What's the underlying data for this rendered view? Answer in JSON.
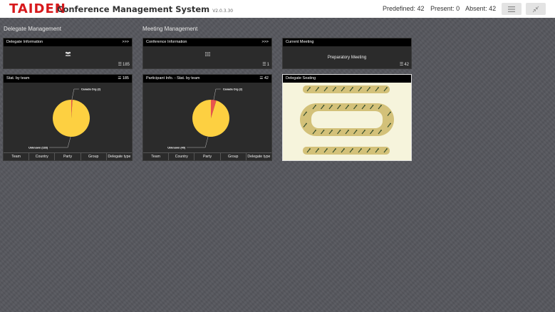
{
  "header": {
    "brand": "TAIDEN",
    "title": "Conference Management System",
    "version": "V2.0.3.30",
    "predefined": "Predefined: 42",
    "present": "Present: 0",
    "absent": "Absent: 42",
    "menu_icon": "menu-icon",
    "collapse_icon": "collapse-icon"
  },
  "sections": {
    "delegate": "Delegate Management",
    "meeting": "Meeting Management"
  },
  "panels": {
    "delegate_info": {
      "title": "Delegate Information",
      "more": ">>>",
      "count": "185",
      "icon": "users-icon"
    },
    "conference_info": {
      "title": "Conference Information",
      "more": ">>>",
      "count": "1",
      "icon": "list-icon"
    },
    "current_meeting": {
      "title": "Current Meeting",
      "name": "Preparatory Meeting",
      "count": "42"
    },
    "stat_team": {
      "title": "Stat. by team",
      "count": "185",
      "tabs": [
        "Team",
        "Country",
        "Party",
        "Group",
        "Delegate type"
      ]
    },
    "participant_stat": {
      "title": "Participant Info. - Stat. by team",
      "count": "42",
      "tabs": [
        "Team",
        "Country",
        "Party",
        "Group",
        "Delegate type"
      ]
    },
    "seating": {
      "title": "Delegate Seating"
    }
  },
  "chart_data": [
    {
      "type": "pie",
      "slices": [
        {
          "label": "Canada Org (2)",
          "value": 2,
          "color": "#e8554e"
        },
        {
          "label": "Unknown (183)",
          "value": 183,
          "color": "#fdd041"
        }
      ]
    },
    {
      "type": "pie",
      "slices": [
        {
          "label": "Canada Org (2)",
          "value": 2,
          "color": "#e8554e"
        },
        {
          "label": "Unknown (40)",
          "value": 40,
          "color": "#fdd041"
        }
      ]
    }
  ],
  "colors": {
    "brand": "#d7191c",
    "pie_main": "#fdd041",
    "pie_minor": "#e8554e"
  }
}
